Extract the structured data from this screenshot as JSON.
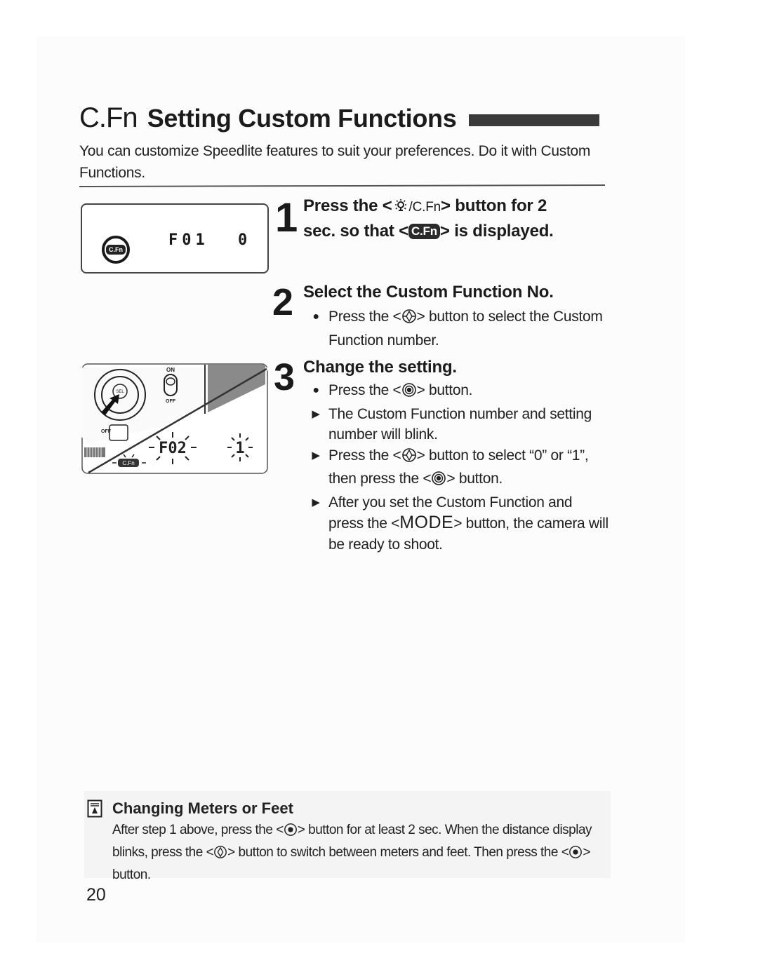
{
  "header": {
    "title_prefix": "C.Fn",
    "title": "Setting Custom Functions"
  },
  "intro": "You can customize Speedlite features to suit your preferences. Do it with Custom Functions.",
  "lcd_panel": {
    "function_number": "F01",
    "setting_value": "0",
    "badge": "C.Fn"
  },
  "illustration": {
    "switch_on": "ON",
    "switch_off": "OFF",
    "lever_off": "OFF",
    "dial_label": "SEL",
    "blinking_function": "F02",
    "blinking_value": "1",
    "badge": "C.Fn"
  },
  "steps": [
    {
      "number": "1",
      "title_a": "Press the <",
      "title_icon": "light-cfn-button-icon",
      "title_icon_text": "/C.Fn",
      "title_b": "> button for 2",
      "title_line2_a": "sec. so that <",
      "title_badge": "C.Fn",
      "title_line2_b": "> is displayed."
    },
    {
      "number": "2",
      "title": "Select the Custom Function No.",
      "items": [
        {
          "marker": "bullet",
          "text_a": "Press the <",
          "icon": "select-dial-icon",
          "text_b": "> button to select the Custom Function number."
        }
      ]
    },
    {
      "number": "3",
      "title": "Change the setting.",
      "items": [
        {
          "marker": "bullet",
          "text_a": "Press the <",
          "icon": "set-button-icon",
          "text_b": "> button."
        },
        {
          "marker": "arrow",
          "text": "The Custom Function number and setting number will blink."
        },
        {
          "marker": "arrow",
          "text_a": "Press the <",
          "icon": "select-dial-icon",
          "text_b": "> button to select “0” or “1”, then press the <",
          "icon2": "set-button-icon",
          "text_c": "> button."
        },
        {
          "marker": "arrow",
          "text_a": "After you set the Custom Function and press the <",
          "mode_word": "MODE",
          "text_b": "> button, the camera will be ready to shoot."
        }
      ]
    }
  ],
  "note": {
    "icon": "note-icon",
    "title": "Changing Meters or Feet",
    "text_a": "After step 1 above, press the <",
    "text_b": "> button for at least 2 sec. When the distance display blinks, press the <",
    "text_c": "> button to switch between meters and feet. Then press the <",
    "text_d": "> button."
  },
  "page_number": "20",
  "colors": {
    "text": "#1f1f1f",
    "title_bar": "#3a3a3a",
    "note_bg": "#f4f4f4"
  }
}
